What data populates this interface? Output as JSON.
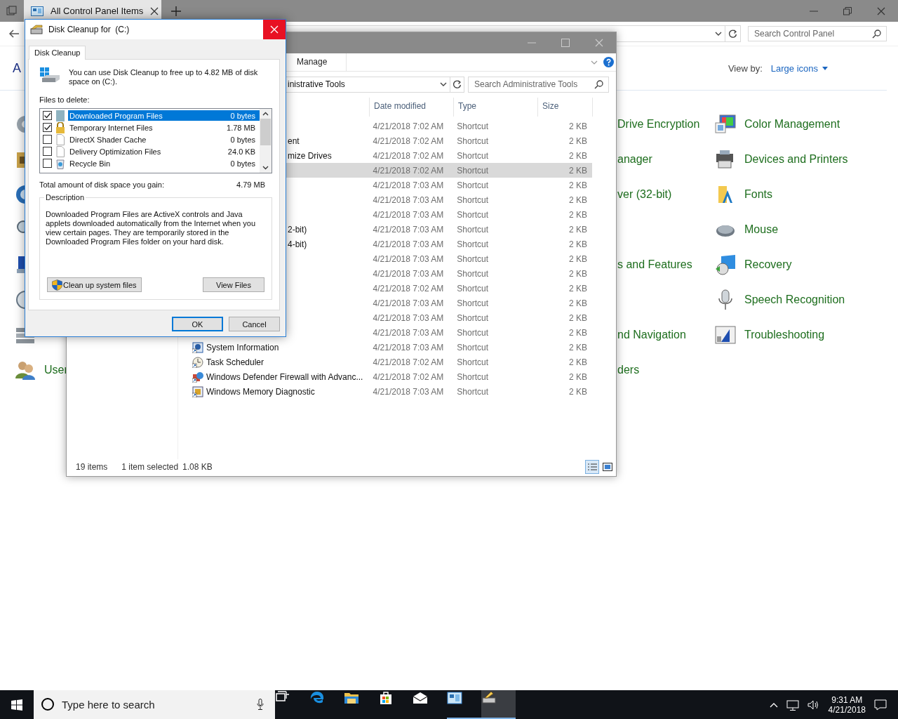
{
  "control_panel": {
    "tab": "All Control Panel Items",
    "search": {
      "placeholder": "Search Control Panel"
    },
    "heading": "A",
    "view_by_label": "View by:",
    "view_by_value": "Large icons",
    "left_column": [
      {
        "kind": "icon"
      },
      {
        "kind": "icon"
      },
      {
        "kind": "icon"
      },
      {
        "kind": "icon"
      },
      {
        "kind": "icon"
      },
      {
        "kind": "icon"
      },
      {
        "kind": "icon"
      },
      {
        "kind": "item",
        "label": "User"
      }
    ],
    "middle_column": [
      {
        "kind": "item",
        "label": "Drive Encryption"
      },
      {
        "kind": "item",
        "label": "anager"
      },
      {
        "kind": "item",
        "label": "ver (32-bit)"
      },
      {
        "kind": "blank"
      },
      {
        "kind": "item",
        "label": "s and Features"
      },
      {
        "kind": "blank"
      },
      {
        "kind": "item",
        "label": "nd Navigation"
      },
      {
        "kind": "item",
        "label": "ders"
      }
    ],
    "right_column": [
      {
        "label": "Color Management"
      },
      {
        "label": "Devices and Printers"
      },
      {
        "label": "Fonts"
      },
      {
        "label": "Mouse"
      },
      {
        "label": "Recovery"
      },
      {
        "label": "Speech Recognition"
      },
      {
        "label": "Troubleshooting"
      }
    ]
  },
  "explorer": {
    "ribbon_tab": "Manage",
    "address": "inistrative Tools",
    "search": {
      "placeholder": "Search Administrative Tools"
    },
    "columns": [
      "Date modified",
      "Type",
      "Size"
    ],
    "rows": [
      {
        "kind": "hidden",
        "date": "4/21/2018 7:02 AM",
        "type": "Shortcut",
        "size": "2 KB",
        "selected": false
      },
      {
        "kind": "partial",
        "name": "ent",
        "date": "4/21/2018 7:02 AM",
        "type": "Shortcut",
        "size": "2 KB",
        "selected": false
      },
      {
        "kind": "partial",
        "name": "mize Drives",
        "date": "4/21/2018 7:02 AM",
        "type": "Shortcut",
        "size": "2 KB",
        "selected": false
      },
      {
        "kind": "hidden",
        "date": "4/21/2018 7:02 AM",
        "type": "Shortcut",
        "size": "2 KB",
        "selected": true
      },
      {
        "kind": "hidden",
        "date": "4/21/2018 7:03 AM",
        "type": "Shortcut",
        "size": "2 KB",
        "selected": false
      },
      {
        "kind": "hidden",
        "date": "4/21/2018 7:03 AM",
        "type": "Shortcut",
        "size": "2 KB",
        "selected": false
      },
      {
        "kind": "hidden",
        "date": "4/21/2018 7:03 AM",
        "type": "Shortcut",
        "size": "2 KB",
        "selected": false
      },
      {
        "kind": "partial",
        "name": "2-bit)",
        "date": "4/21/2018 7:03 AM",
        "type": "Shortcut",
        "size": "2 KB",
        "selected": false
      },
      {
        "kind": "partial",
        "name": "4-bit)",
        "date": "4/21/2018 7:03 AM",
        "type": "Shortcut",
        "size": "2 KB",
        "selected": false
      },
      {
        "kind": "hidden",
        "date": "4/21/2018 7:03 AM",
        "type": "Shortcut",
        "size": "2 KB",
        "selected": false
      },
      {
        "kind": "hidden",
        "date": "4/21/2018 7:03 AM",
        "type": "Shortcut",
        "size": "2 KB",
        "selected": false
      },
      {
        "kind": "hidden",
        "date": "4/21/2018 7:02 AM",
        "type": "Shortcut",
        "size": "2 KB",
        "selected": false
      },
      {
        "kind": "hidden",
        "date": "4/21/2018 7:03 AM",
        "type": "Shortcut",
        "size": "2 KB",
        "selected": false
      },
      {
        "kind": "hidden",
        "date": "4/21/2018 7:03 AM",
        "type": "Shortcut",
        "size": "2 KB",
        "selected": false
      },
      {
        "kind": "hidden",
        "date": "4/21/2018 7:03 AM",
        "type": "Shortcut",
        "size": "2 KB",
        "selected": false
      },
      {
        "kind": "full",
        "name": "System Information",
        "date": "4/21/2018 7:03 AM",
        "type": "Shortcut",
        "size": "2 KB",
        "selected": false
      },
      {
        "kind": "full",
        "name": "Task Scheduler",
        "date": "4/21/2018 7:02 AM",
        "type": "Shortcut",
        "size": "2 KB",
        "selected": false
      },
      {
        "kind": "full",
        "name": "Windows Defender Firewall with Advanc...",
        "date": "4/21/2018 7:02 AM",
        "type": "Shortcut",
        "size": "2 KB",
        "selected": false
      },
      {
        "kind": "full",
        "name": "Windows Memory Diagnostic",
        "date": "4/21/2018 7:03 AM",
        "type": "Shortcut",
        "size": "2 KB",
        "selected": false
      }
    ],
    "status": {
      "count": "19 items",
      "selection": "1 item selected",
      "selection_size": "1.08 KB"
    }
  },
  "dialog": {
    "title": "Disk Cleanup for  (C:)",
    "tab": "Disk Cleanup",
    "intro": "You can use Disk Cleanup to free up to 4.82 MB of disk space on  (C:).",
    "files_label": "Files to delete:",
    "files": [
      {
        "kind": "program",
        "name": "Downloaded Program Files",
        "size": "0 bytes",
        "checked": true,
        "selected": true
      },
      {
        "kind": "lock",
        "name": "Temporary Internet Files",
        "size": "1.78 MB",
        "checked": true,
        "selected": false
      },
      {
        "kind": "page",
        "name": "DirectX Shader Cache",
        "size": "0 bytes",
        "checked": false,
        "selected": false
      },
      {
        "kind": "page",
        "name": "Delivery Optimization Files",
        "size": "24.0 KB",
        "checked": false,
        "selected": false
      },
      {
        "kind": "bin",
        "name": "Recycle Bin",
        "size": "0 bytes",
        "checked": false,
        "selected": false
      }
    ],
    "total_label": "Total amount of disk space you gain:",
    "total": "4.79 MB",
    "description_title": "Description",
    "description": "Downloaded Program Files are ActiveX controls and Java applets downloaded automatically from the Internet when you view certain pages. They are temporarily stored in the Downloaded Program Files folder on your hard disk.",
    "system_button": "Clean up system files",
    "view_button": "View Files",
    "ok": "OK",
    "cancel": "Cancel"
  },
  "taskbar": {
    "search_placeholder": "Type here to search",
    "apps": [
      {
        "kind": "taskview",
        "running": false,
        "selected": false
      },
      {
        "kind": "edge",
        "running": false,
        "selected": false
      },
      {
        "kind": "folder",
        "running": false,
        "selected": false
      },
      {
        "kind": "store",
        "running": false,
        "selected": false
      },
      {
        "kind": "mail",
        "running": false,
        "selected": false
      },
      {
        "kind": "controlpanel",
        "running": true,
        "selected": false
      },
      {
        "kind": "cleanup",
        "running": true,
        "selected": true
      }
    ],
    "time": "9:31 AM",
    "date": "4/21/2018"
  }
}
